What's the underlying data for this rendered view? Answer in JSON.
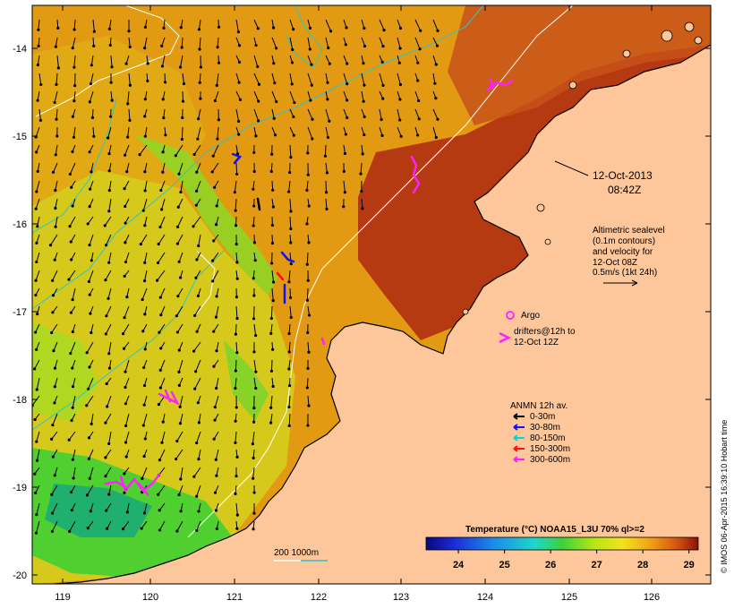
{
  "map": {
    "date": "12-Oct-2013",
    "time": "08:42Z",
    "lon_ticks": [
      "119",
      "120",
      "121",
      "122",
      "123",
      "124",
      "125",
      "126"
    ],
    "lat_ticks": [
      "-14",
      "-15",
      "-16",
      "-17",
      "-18",
      "-19",
      "-20"
    ],
    "altimetry_lines": [
      "Altimetric sealevel",
      "(0.1m contours)",
      "and velocity for",
      "12-Oct 08Z",
      "0.5m/s (1kt 24h)"
    ],
    "argo_label": "Argo",
    "drifters_lines": [
      "drifters@12h to",
      "12-Oct 12Z"
    ],
    "anmn": {
      "title": "ANMN 12h av.",
      "items": [
        {
          "label": "0-30m",
          "color": "#000000"
        },
        {
          "label": "30-80m",
          "color": "#1010ff"
        },
        {
          "label": "80-150m",
          "color": "#00d8d8"
        },
        {
          "label": "150-300m",
          "color": "#ff1010"
        },
        {
          "label": "300-600m",
          "color": "#ff20ff"
        }
      ]
    },
    "bathy_label": "200  1000m",
    "colorbar": {
      "title": "Temperature (°C) NOAA15_L3U 70% ql>=2",
      "ticks": [
        "24",
        "25",
        "26",
        "27",
        "28",
        "29"
      ],
      "range": [
        23.3,
        29.2
      ]
    },
    "credit": "© IMOS 06-Apr-2015 16:39:10 Hobart time",
    "colors": {
      "land": "#fdc79b",
      "warm_sst": "#e39a13",
      "hot_sst": "#b53a12",
      "argo": "#ff20ff",
      "contour": "#2bc6c6"
    }
  }
}
